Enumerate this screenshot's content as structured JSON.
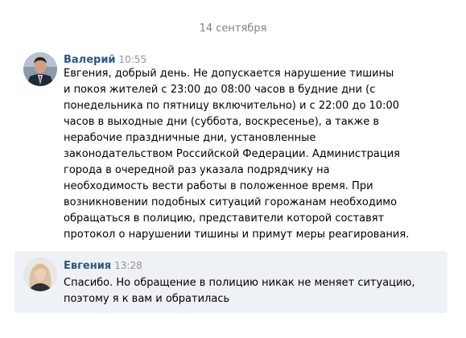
{
  "date_separator": "14 сентября",
  "messages": [
    {
      "author": "Валерий",
      "time": "10:55",
      "lines": [
        "Евгения, добрый день. Не допускается нарушение тишины",
        "и покоя жителей с 23:00 до 08:00 часов в будние дни (с",
        "понедельника по пятницу включительно) и с 22:00 до 10:00",
        "часов в выходные дни (суббота, воскресенье), а также в",
        "нерабочие праздничные дни, установленные",
        "законодательством Российской Федерации. Администрация",
        "города в очередной раз указала подрядчику на",
        "необходимость вести работы в положенное время. При",
        "возникновении подобных ситуаций горожанам необходимо",
        "обращаться в полицию, представители которой составят",
        "протокол о нарушении тишины и примут меры реагирования."
      ],
      "avatar_icon": "avatar-man-suit",
      "highlighted": false
    },
    {
      "author": "Евгения",
      "time": "13:28",
      "lines": [
        "Спасибо. Но обращение в полицию никак не меняет ситуацию,",
        "поэтому я к вам и обратилась"
      ],
      "avatar_icon": "avatar-woman-blonde",
      "highlighted": true,
      "background_color": "#eef1f5"
    }
  ],
  "colors": {
    "author": "#2a5885",
    "time": "#939393",
    "date": "#828282",
    "highlight_bg": "#eef1f5"
  }
}
